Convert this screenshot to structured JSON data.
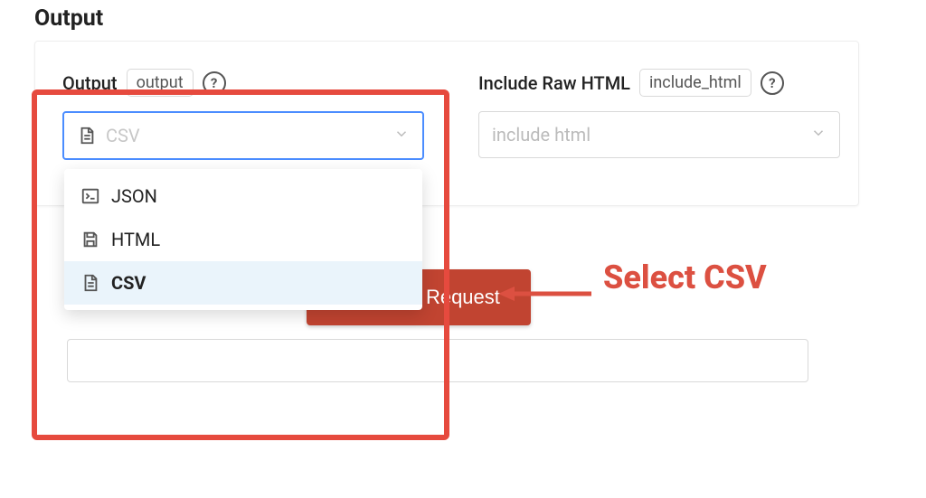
{
  "heading": "Output",
  "output_field": {
    "label": "Output",
    "badge": "output",
    "selected_value": "CSV",
    "options": [
      {
        "label": "JSON"
      },
      {
        "label": "HTML"
      },
      {
        "label": "CSV"
      }
    ]
  },
  "include_html_field": {
    "label": "Include Raw HTML",
    "badge": "include_html",
    "placeholder": "include html"
  },
  "annotation": "Select CSV",
  "button": "Send API Request"
}
